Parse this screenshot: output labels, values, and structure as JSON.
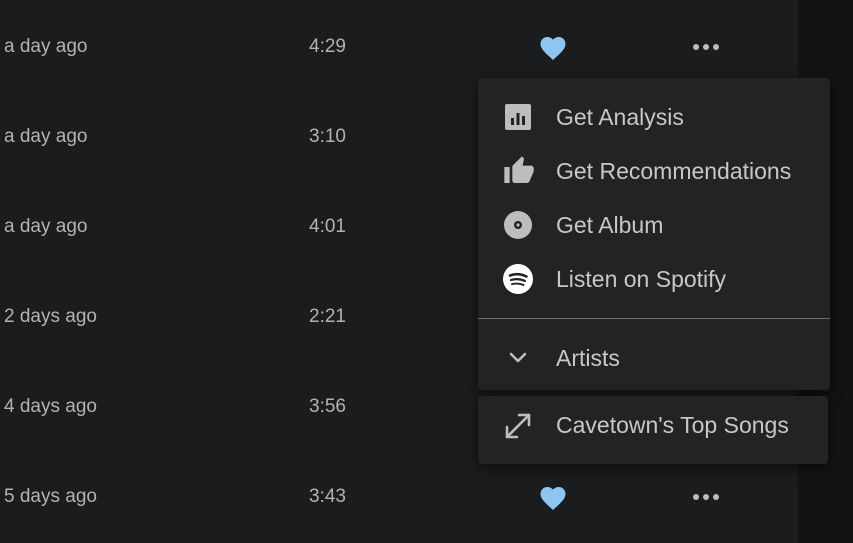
{
  "colors": {
    "background": "#1b1c1e",
    "menu_background": "#222325",
    "text_secondary": "#b3b3b3",
    "menu_text": "#c8c8c8",
    "heart_accent": "#8ec6f0",
    "icon_gray": "#bdbdbd"
  },
  "tracks": [
    {
      "added": "a day ago",
      "duration": "4:29",
      "liked": true,
      "heart_icon": "heart-icon",
      "more_icon": "more-horizontal-icon"
    },
    {
      "added": "a day ago",
      "duration": "3:10"
    },
    {
      "added": "a day ago",
      "duration": "4:01"
    },
    {
      "added": "2 days ago",
      "duration": "2:21"
    },
    {
      "added": "4 days ago",
      "duration": "3:56"
    },
    {
      "added": "5 days ago",
      "duration": "3:43",
      "liked": true,
      "heart_icon": "heart-icon",
      "more_icon": "more-horizontal-icon"
    }
  ],
  "context_menu": {
    "items": [
      {
        "label": "Get Analysis",
        "icon": "analytics-icon"
      },
      {
        "label": "Get Recommendations",
        "icon": "thumb-up-icon"
      },
      {
        "label": "Get Album",
        "icon": "album-icon"
      },
      {
        "label": "Listen on Spotify",
        "icon": "spotify-icon"
      }
    ],
    "artists": {
      "label": "Artists",
      "icon": "chevron-down-icon"
    },
    "submenu": {
      "label": "Cavetown's Top Songs",
      "icon": "expand-icon"
    }
  }
}
